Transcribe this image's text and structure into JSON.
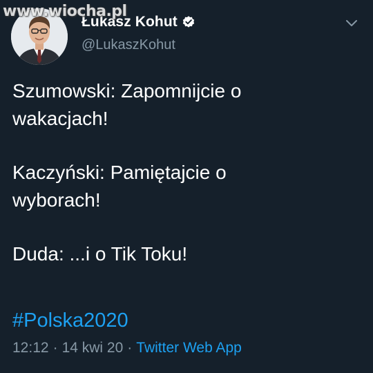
{
  "author": {
    "display_name": "Łukasz Kohut",
    "handle": "@LukaszKohut",
    "verified": true
  },
  "watermark": "www.wiocha.pl",
  "tweet": {
    "paragraphs": [
      "Szumowski: Zapomnijcie o\nwakacjach!",
      "Kaczyński: Pamiętajcie o\nwyborach!",
      "Duda: ...i o Tik Toku!"
    ],
    "hashtag": "#Polska2020",
    "time": "12:12",
    "date": "14 kwi 20",
    "separator": "·",
    "source": "Twitter Web App"
  },
  "colors": {
    "background": "#15202b",
    "accent": "#1da1f2",
    "secondary_text": "#8899a6"
  },
  "icons": {
    "verified": "verified-badge-icon",
    "menu": "chevron-down-icon"
  }
}
